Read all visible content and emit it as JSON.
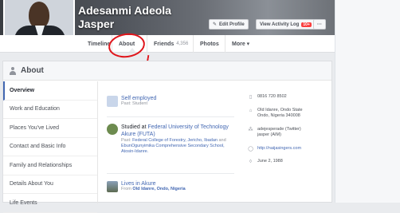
{
  "profile": {
    "first_line": "Adesanmi Adeola",
    "second_line": "Jasper"
  },
  "actions": {
    "edit_profile": "Edit Profile",
    "view_activity_log": "View Activity Log",
    "activity_badge": "10+",
    "more": "···"
  },
  "nav": {
    "timeline": "Timeline",
    "about": "About",
    "friends": "Friends",
    "friends_count": "4,356",
    "photos": "Photos",
    "more": "More ▾"
  },
  "about": {
    "title": "About",
    "sections": [
      "Overview",
      "Work and Education",
      "Places You've Lived",
      "Contact and Basic Info",
      "Family and Relationships",
      "Details About You",
      "Life Events"
    ],
    "active_section": "Overview"
  },
  "overview": {
    "work_title": "Self employed",
    "work_past": "Past: Student",
    "edu_prefix": "Studied at ",
    "edu_school": "Federal University of Technology Akure (FUTA)",
    "edu_past_label": "Past: ",
    "edu_past_1": "Federal College of Forestry, Jericho, Ibadan",
    "edu_past_and": " and ",
    "edu_past_2": "EbunOgunyimika Comprehensive Secondary School, Atosin-Idanre.",
    "lives_title": "Lives in Akure",
    "from_label": "From ",
    "from_place": "Old Idanre, Ondo, Nigeria"
  },
  "contact": {
    "phone": "0816 720 8502",
    "address": "Old Idanre, Ondo State\nOndo, Nigeria 340008",
    "screen_names": "adejesperade (Twitter)\njasper (AIM)",
    "website": "http://naijasingers.com",
    "birthday": "June 2, 1988"
  },
  "icons": {
    "work": "briefcase-icon",
    "education": "school-logo-icon",
    "lives": "city-photo-icon",
    "phone": "phone-icon",
    "address": "home-icon",
    "screen": "chat-icon",
    "web": "globe-icon",
    "birthday": "cake-icon"
  },
  "colors": {
    "accent": "#4267b2",
    "annotation": "#e0151b",
    "badge": "#fa3e3e"
  }
}
